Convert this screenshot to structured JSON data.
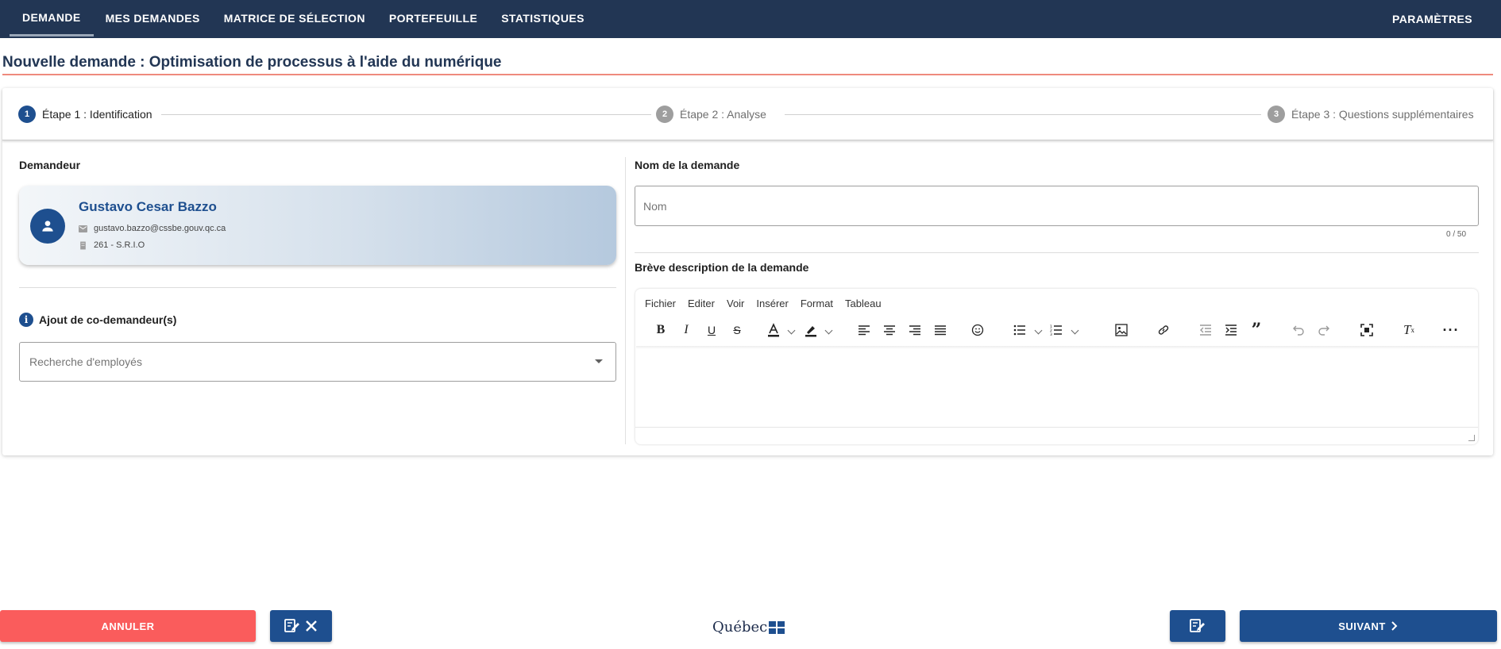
{
  "nav": {
    "tabs": [
      "DEMANDE",
      "MES DEMANDES",
      "MATRICE DE SÉLECTION",
      "PORTEFEUILLE",
      "STATISTIQUES"
    ],
    "active_tab": "DEMANDE",
    "settings": "PARAMÈTRES"
  },
  "page": {
    "title": "Nouvelle demande : Optimisation de processus à l'aide du numérique"
  },
  "stepper": {
    "steps": [
      {
        "number": "1",
        "label": "Étape 1 : Identification",
        "active": true
      },
      {
        "number": "2",
        "label": "Étape 2 : Analyse",
        "active": false
      },
      {
        "number": "3",
        "label": "Étape 3 : Questions supplémentaires",
        "active": false
      }
    ]
  },
  "requester": {
    "section_label": "Demandeur",
    "name": "Gustavo Cesar Bazzo",
    "email": "gustavo.bazzo@cssbe.gouv.qc.ca",
    "department": "261 - S.R.I.O",
    "icons": {
      "avatar": "person-icon",
      "email": "mail-icon",
      "department": "building-icon"
    }
  },
  "co_requesters": {
    "label": "Ajout de co-demandeur(s)",
    "placeholder": "Recherche d'employés"
  },
  "request_name": {
    "label": "Nom de la demande",
    "placeholder": "Nom",
    "counter": "0 / 50"
  },
  "description": {
    "label": "Brève description de la demande",
    "menu": [
      "Fichier",
      "Editer",
      "Voir",
      "Insérer",
      "Format",
      "Tableau"
    ]
  },
  "footer": {
    "cancel": "ANNULER",
    "next": "SUIVANT",
    "logo_text": "Québec"
  },
  "colors": {
    "nav_bg": "#223654",
    "primary": "#1e4f8f",
    "danger": "#fa5c5c",
    "title_rule": "#ef8a7d"
  }
}
